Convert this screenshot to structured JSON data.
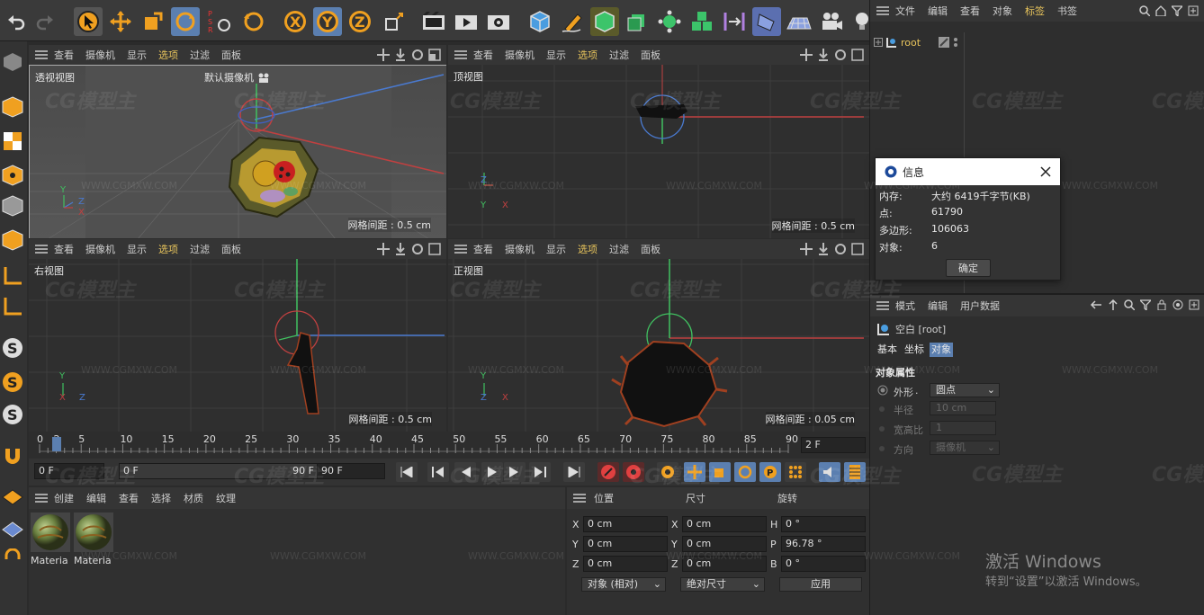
{
  "toolbar": {
    "icons": [
      "undo-icon",
      "redo-icon",
      "select-icon",
      "move-icon",
      "scale-icon",
      "rotate-icon",
      "psr-icon",
      "rotate-icon",
      "x-axis-icon",
      "y-axis-icon",
      "z-axis-icon",
      "coord-system-icon",
      "render-region-icon",
      "render-viewport-icon",
      "render-settings-icon",
      "cube-icon",
      "pen-icon",
      "subdivision-icon",
      "extrude-icon",
      "array-icon",
      "mograph-icon",
      "deformer-icon",
      "plane-icon",
      "scene-icon",
      "camera-icon",
      "light-icon"
    ]
  },
  "viewports": [
    {
      "menu": [
        "查看",
        "摄像机",
        "显示",
        "选项",
        "过滤",
        "面板"
      ],
      "title": "透视视图",
      "camera": "默认摄像机",
      "grid": "网格间距 : 0.5 cm"
    },
    {
      "menu": [
        "查看",
        "摄像机",
        "显示",
        "选项",
        "过滤",
        "面板"
      ],
      "title": "顶视图",
      "grid": "网格间距 : 0.5 cm"
    },
    {
      "menu": [
        "查看",
        "摄像机",
        "显示",
        "选项",
        "过滤",
        "面板"
      ],
      "title": "右视图",
      "grid": "网格间距 : 0.5 cm"
    },
    {
      "menu": [
        "查看",
        "摄像机",
        "显示",
        "选项",
        "过滤",
        "面板"
      ],
      "title": "正视图",
      "grid": "网格间距 : 0.05 cm"
    }
  ],
  "timeline": {
    "ticks": [
      "0",
      "2",
      "5",
      "10",
      "15",
      "20",
      "25",
      "30",
      "35",
      "40",
      "45",
      "50",
      "55",
      "60",
      "65",
      "70",
      "75",
      "80",
      "85",
      "90"
    ],
    "current_frame": "2 F",
    "start": "0 F",
    "min": "0 F",
    "max": "90 F",
    "end": "90 F"
  },
  "materials": {
    "menu": [
      "创建",
      "编辑",
      "查看",
      "选择",
      "材质",
      "纹理"
    ],
    "items": [
      "Materia",
      "Materia"
    ]
  },
  "coords": {
    "headers": [
      "位置",
      "尺寸",
      "旋转"
    ],
    "rows": [
      {
        "axis": "X",
        "pos": "0 cm",
        "axis2": "X",
        "size": "0 cm",
        "axis3": "H",
        "rot": "0 °"
      },
      {
        "axis": "Y",
        "pos": "0 cm",
        "axis2": "Y",
        "size": "0 cm",
        "axis3": "P",
        "rot": "96.78 °"
      },
      {
        "axis": "Z",
        "pos": "0 cm",
        "axis2": "Z",
        "size": "0 cm",
        "axis3": "B",
        "rot": "0 °"
      }
    ],
    "mode": "对象 (相对)",
    "size_mode": "绝对尺寸",
    "apply": "应用"
  },
  "object_manager": {
    "menu": [
      "文件",
      "编辑",
      "查看",
      "对象",
      "标签",
      "书签"
    ],
    "highlight": "标签",
    "root": "root"
  },
  "info_dialog": {
    "title": "信息",
    "rows": [
      {
        "label": "内存:",
        "value": "大约 6419千字节(KB)"
      },
      {
        "label": "点:",
        "value": "61790"
      },
      {
        "label": "多边形:",
        "value": "106063"
      },
      {
        "label": "对象:",
        "value": "6"
      }
    ],
    "ok": "确定"
  },
  "attributes": {
    "menu": [
      "模式",
      "编辑",
      "用户数据"
    ],
    "object_title": "空白 [root]",
    "tabs": [
      "基本",
      "坐标",
      "对象"
    ],
    "active_tab": "对象",
    "section": "对象属性",
    "props": [
      {
        "label": "外形",
        "value": "圆点"
      },
      {
        "label": "半径",
        "value": "10 cm"
      },
      {
        "label": "宽高比",
        "value": "1"
      },
      {
        "label": "方向",
        "value": "摄像机"
      }
    ]
  },
  "activation": {
    "line1": "激活 Windows",
    "line2": "转到“设置”以激活 Windows。"
  },
  "watermark": {
    "logo": "CG模型主",
    "url": "WWW.CGMXW.COM"
  }
}
